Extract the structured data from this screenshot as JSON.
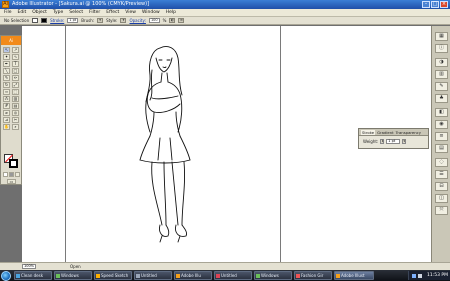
{
  "window": {
    "title": "Adobe Illustrator - [Sakura.ai @ 100% (CMYK/Preview)]"
  },
  "menu": [
    "File",
    "Edit",
    "Object",
    "Type",
    "Select",
    "Filter",
    "Effect",
    "View",
    "Window",
    "Help"
  ],
  "control": {
    "selection": "No Selection",
    "stroke_label": "Stroke:",
    "stroke_value": "1 pt",
    "brush_label": "Brush:",
    "style_label": "Style:",
    "opacity_label": "Opacity:",
    "opacity_value": "100",
    "opacity_unit": "%"
  },
  "tools": {
    "header": "Ai",
    "items": [
      "selection",
      "direct-selection",
      "magic-wand",
      "lasso",
      "pen",
      "type",
      "line",
      "rectangle",
      "paintbrush",
      "pencil",
      "rotate",
      "scale",
      "warp",
      "free-transform",
      "symbol-sprayer",
      "graph",
      "mesh",
      "gradient",
      "eyedropper",
      "blend",
      "slice",
      "scissors",
      "hand",
      "zoom"
    ]
  },
  "stroke_panel": {
    "tabs": [
      "Stroke",
      "Gradient",
      "Transparency"
    ],
    "weight_label": "Weight:",
    "weight_value": "1 pt"
  },
  "status": {
    "zoom": "100%",
    "info": "Open"
  },
  "taskbar": {
    "buttons": [
      {
        "label": "Clean desk",
        "color": "#4aa3df"
      },
      {
        "label": "Windows",
        "color": "#6bbf59"
      },
      {
        "label": "Speed Sketch",
        "color": "#ffb000"
      },
      {
        "label": "Untitled",
        "color": "#9aa6b8"
      },
      {
        "label": "Adobe Illu",
        "color": "#f7a11a"
      },
      {
        "label": "Untitled",
        "color": "#d45"
      },
      {
        "label": "Windows",
        "color": "#6bbf59"
      },
      {
        "label": "Fashion Gir",
        "color": "#e55"
      },
      {
        "label": "Adobe Illust",
        "color": "#f7a11a"
      }
    ],
    "clock": "11:53 PM"
  },
  "colors": {
    "accent": "#f28a1a",
    "titlebar": "#2a63c2",
    "taskbar": "#1a1f28"
  }
}
